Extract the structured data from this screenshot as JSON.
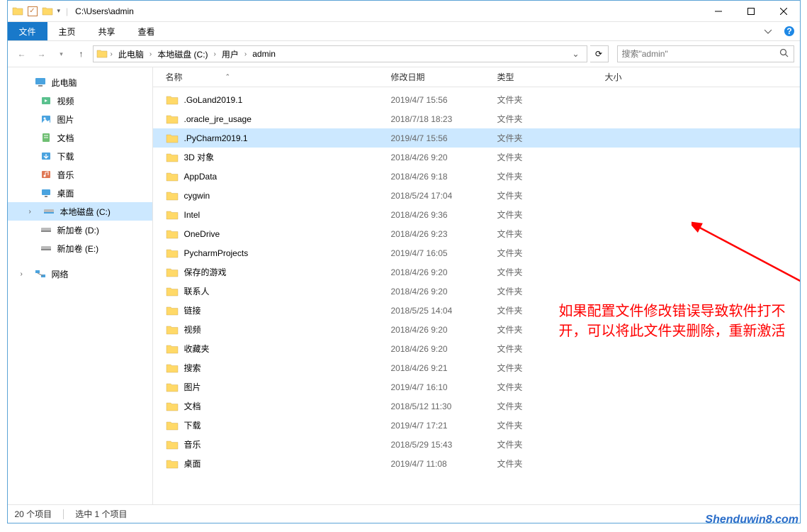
{
  "titlebar": {
    "title": "C:\\Users\\admin"
  },
  "ribbon": {
    "file": "文件",
    "tabs": [
      "主页",
      "共享",
      "查看"
    ]
  },
  "address": {
    "segments": [
      "此电脑",
      "本地磁盘 (C:)",
      "用户",
      "admin"
    ],
    "dropdown_char": "›"
  },
  "search": {
    "placeholder": "搜索\"admin\""
  },
  "sidebar": {
    "thispc": "此电脑",
    "items": [
      {
        "label": "视频",
        "icon": "video"
      },
      {
        "label": "图片",
        "icon": "picture"
      },
      {
        "label": "文档",
        "icon": "document"
      },
      {
        "label": "下载",
        "icon": "download"
      },
      {
        "label": "音乐",
        "icon": "music"
      },
      {
        "label": "桌面",
        "icon": "desktop"
      }
    ],
    "drives": [
      {
        "label": "本地磁盘 (C:)",
        "selected": true
      },
      {
        "label": "新加卷 (D:)",
        "selected": false
      },
      {
        "label": "新加卷 (E:)",
        "selected": false
      }
    ],
    "network": "网络"
  },
  "columns": {
    "name": "名称",
    "date": "修改日期",
    "type": "类型",
    "size": "大小"
  },
  "files": [
    {
      "name": ".GoLand2019.1",
      "date": "2019/4/7 15:56",
      "type": "文件夹",
      "selected": false
    },
    {
      "name": ".oracle_jre_usage",
      "date": "2018/7/18 18:23",
      "type": "文件夹",
      "selected": false
    },
    {
      "name": ".PyCharm2019.1",
      "date": "2019/4/7 15:56",
      "type": "文件夹",
      "selected": true
    },
    {
      "name": "3D 对象",
      "date": "2018/4/26 9:20",
      "type": "文件夹",
      "selected": false
    },
    {
      "name": "AppData",
      "date": "2018/4/26 9:18",
      "type": "文件夹",
      "selected": false
    },
    {
      "name": "cygwin",
      "date": "2018/5/24 17:04",
      "type": "文件夹",
      "selected": false
    },
    {
      "name": "Intel",
      "date": "2018/4/26 9:36",
      "type": "文件夹",
      "selected": false
    },
    {
      "name": "OneDrive",
      "date": "2018/4/26 9:23",
      "type": "文件夹",
      "selected": false
    },
    {
      "name": "PycharmProjects",
      "date": "2019/4/7 16:05",
      "type": "文件夹",
      "selected": false
    },
    {
      "name": "保存的游戏",
      "date": "2018/4/26 9:20",
      "type": "文件夹",
      "selected": false
    },
    {
      "name": "联系人",
      "date": "2018/4/26 9:20",
      "type": "文件夹",
      "selected": false
    },
    {
      "name": "链接",
      "date": "2018/5/25 14:04",
      "type": "文件夹",
      "selected": false
    },
    {
      "name": "视频",
      "date": "2018/4/26 9:20",
      "type": "文件夹",
      "selected": false
    },
    {
      "name": "收藏夹",
      "date": "2018/4/26 9:20",
      "type": "文件夹",
      "selected": false
    },
    {
      "name": "搜索",
      "date": "2018/4/26 9:21",
      "type": "文件夹",
      "selected": false
    },
    {
      "name": "图片",
      "date": "2019/4/7 16:10",
      "type": "文件夹",
      "selected": false
    },
    {
      "name": "文档",
      "date": "2018/5/12 11:30",
      "type": "文件夹",
      "selected": false
    },
    {
      "name": "下载",
      "date": "2019/4/7 17:21",
      "type": "文件夹",
      "selected": false
    },
    {
      "name": "音乐",
      "date": "2018/5/29 15:43",
      "type": "文件夹",
      "selected": false
    },
    {
      "name": "桌面",
      "date": "2019/4/7 11:08",
      "type": "文件夹",
      "selected": false
    }
  ],
  "status": {
    "count": "20 个项目",
    "selection": "选中 1 个项目"
  },
  "annotation": {
    "text": "如果配置文件修改错误导致软件打不开，可以将此文件夹删除，重新激活"
  },
  "watermark": "Shenduwin8.com"
}
